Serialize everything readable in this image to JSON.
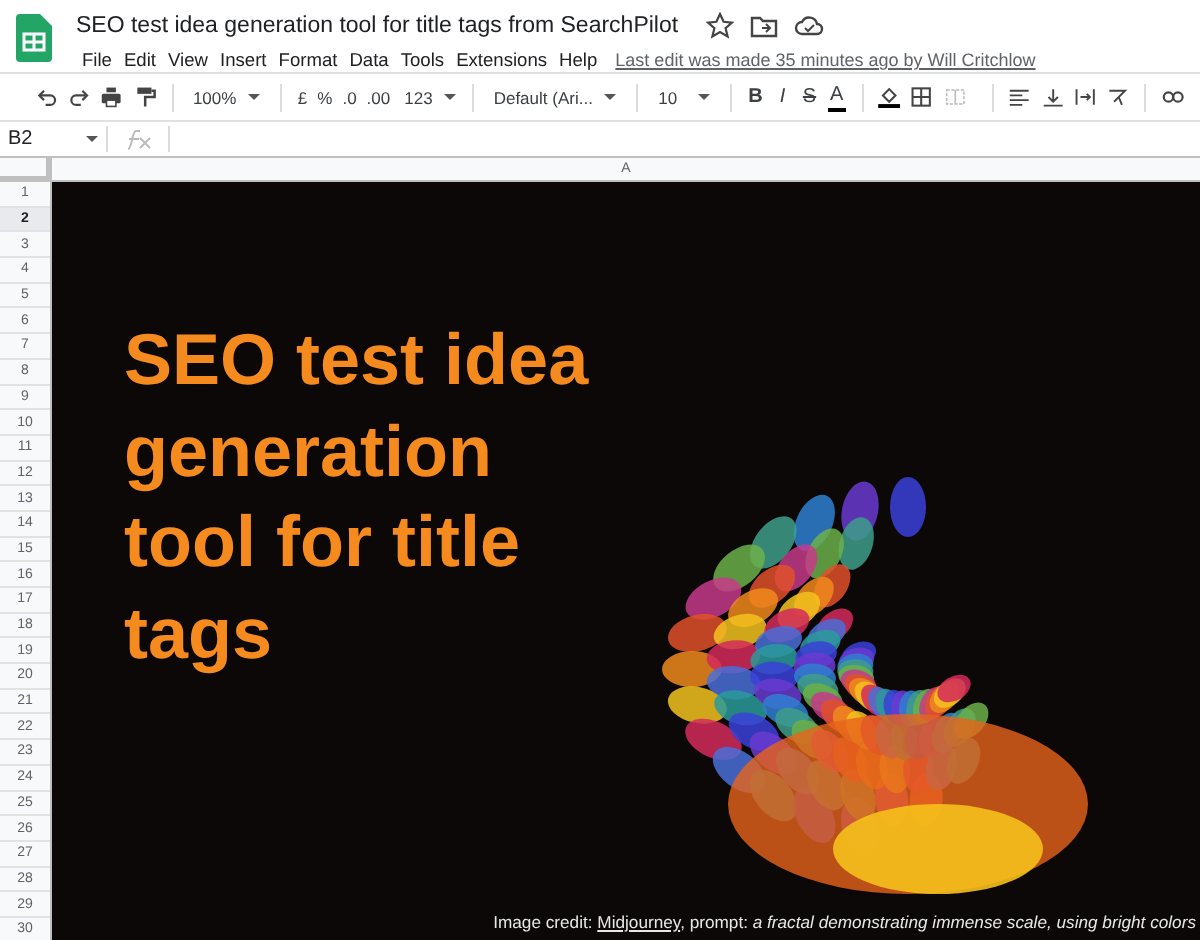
{
  "document": {
    "title": "SEO test idea generation tool for title tags from SearchPilot",
    "starred": false
  },
  "menu": [
    "File",
    "Edit",
    "View",
    "Insert",
    "Format",
    "Data",
    "Tools",
    "Extensions",
    "Help"
  ],
  "last_edit": "Last edit was made 35 minutes ago by Will Critchlow",
  "toolbar": {
    "zoom": "100%",
    "currency": "£",
    "percent": "%",
    "decrease_decimals": ".0",
    "increase_decimals": ".00",
    "number_format": "123",
    "font": "Default (Ari...",
    "font_size": "10",
    "bold": "B",
    "italic": "I",
    "strikethrough": "S",
    "text_color": "A"
  },
  "formula_bar": {
    "cell_reference": "B2"
  },
  "columns": [
    "A"
  ],
  "rows": [
    {
      "label": "1",
      "selected": false
    },
    {
      "label": "2",
      "selected": true
    },
    {
      "label": "3",
      "selected": false
    },
    {
      "label": "4",
      "selected": false
    },
    {
      "label": "5",
      "selected": false
    },
    {
      "label": "6",
      "selected": false
    },
    {
      "label": "7",
      "selected": false
    },
    {
      "label": "8",
      "selected": false
    },
    {
      "label": "9",
      "selected": false
    },
    {
      "label": "10",
      "selected": false
    },
    {
      "label": "11",
      "selected": false
    },
    {
      "label": "12",
      "selected": false
    },
    {
      "label": "13",
      "selected": false
    },
    {
      "label": "14",
      "selected": false
    },
    {
      "label": "15",
      "selected": false
    },
    {
      "label": "16",
      "selected": false
    },
    {
      "label": "17",
      "selected": false
    },
    {
      "label": "18",
      "selected": false
    },
    {
      "label": "19",
      "selected": false
    },
    {
      "label": "20",
      "selected": false
    },
    {
      "label": "21",
      "selected": false
    },
    {
      "label": "22",
      "selected": false
    },
    {
      "label": "23",
      "selected": false
    },
    {
      "label": "24",
      "selected": false
    },
    {
      "label": "25",
      "selected": false
    },
    {
      "label": "26",
      "selected": false
    },
    {
      "label": "27",
      "selected": false
    },
    {
      "label": "28",
      "selected": false
    },
    {
      "label": "29",
      "selected": false
    },
    {
      "label": "30",
      "selected": false
    }
  ],
  "slide": {
    "headline": "SEO test idea generation tool for title tags",
    "credit": {
      "prefix": "Image credit:",
      "link": "Midjourney",
      "rest": ", prompt: *a fractal demonstrating immense scale, using bright colors*"
    }
  }
}
